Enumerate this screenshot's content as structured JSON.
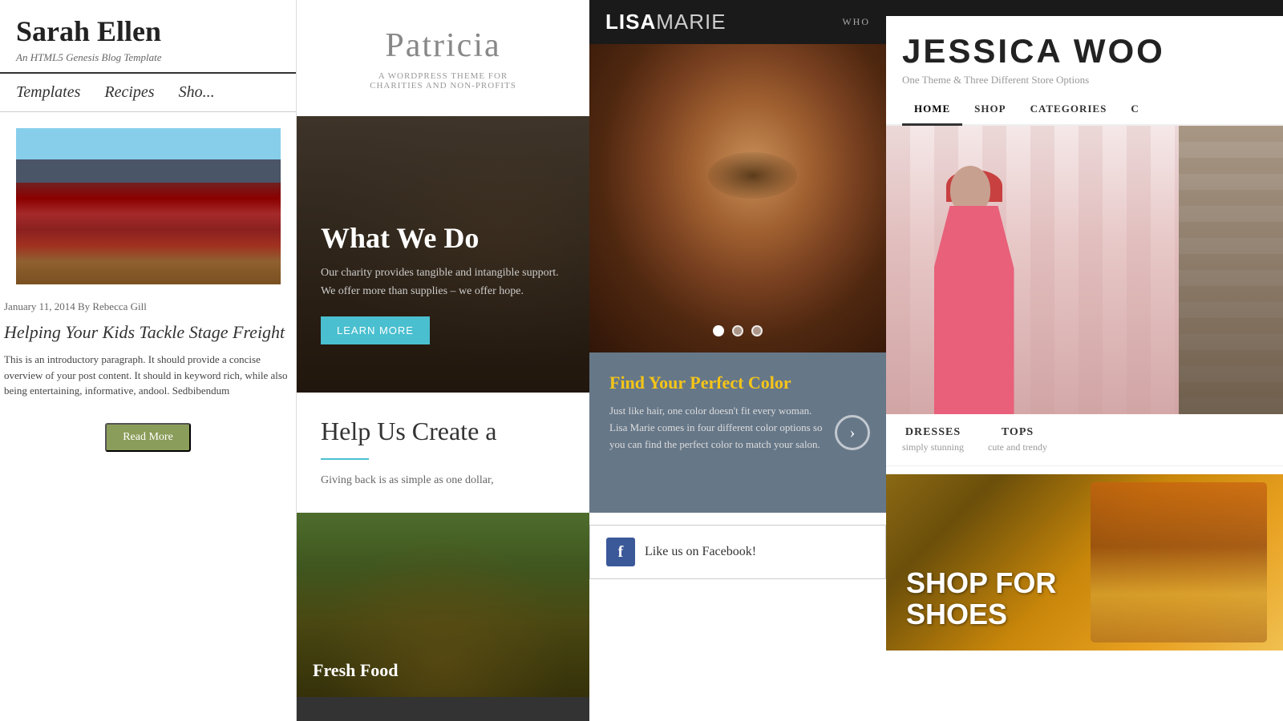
{
  "panels": {
    "sarah": {
      "title": "Sarah Ellen",
      "subtitle": "An HTML5 Genesis Blog Template",
      "nav": [
        "Templates",
        "Recipes",
        "Sho..."
      ],
      "post": {
        "meta": "January 11, 2014 By Rebecca Gill",
        "title": "Helping Your Kids Tackle Stage Freight",
        "excerpt": "This is an introductory paragraph. It should provide a concise overview of your post content. It should in keyword rich, while also being entertaining, informative, andool. Sedbibendum",
        "read_more": "Read More"
      }
    },
    "patricia": {
      "title": "Patricia",
      "tagline": "A WORDPRESS THEME FOR\nCHARITIES AND NON-PROFITS",
      "hero": {
        "title": "What We Do",
        "description": "Our charity provides tangible and intangible support. We offer more than supplies – we offer hope.",
        "button": "LEARN MORE"
      },
      "section": {
        "title": "Help Us Create a",
        "text": "Giving back is as simple as one dollar,"
      },
      "bottom_label": "Fresh Food"
    },
    "lisa": {
      "logo_bold": "LISA",
      "logo_light": "MARIE",
      "nav_item": "WHO",
      "promo": {
        "title": "Find Your Perfect Color",
        "text": "Just like hair, one color doesn't fit every woman. Lisa Marie comes in four different color options so you can find the perfect color to match your salon."
      },
      "facebook": "Like us on Facebook!"
    },
    "jessica": {
      "title": "JESSICA WOO",
      "subtitle": "One Theme & Three Different Store Options",
      "nav": [
        "HOME",
        "SHOP",
        "CATEGORIES",
        "C"
      ],
      "categories": [
        {
          "title": "DRESSES",
          "sub": "simply stunning"
        },
        {
          "title": "TOPS",
          "sub": "cute and trendy"
        }
      ],
      "banner": {
        "title": "SHOP FOR\nSHOES"
      }
    }
  }
}
